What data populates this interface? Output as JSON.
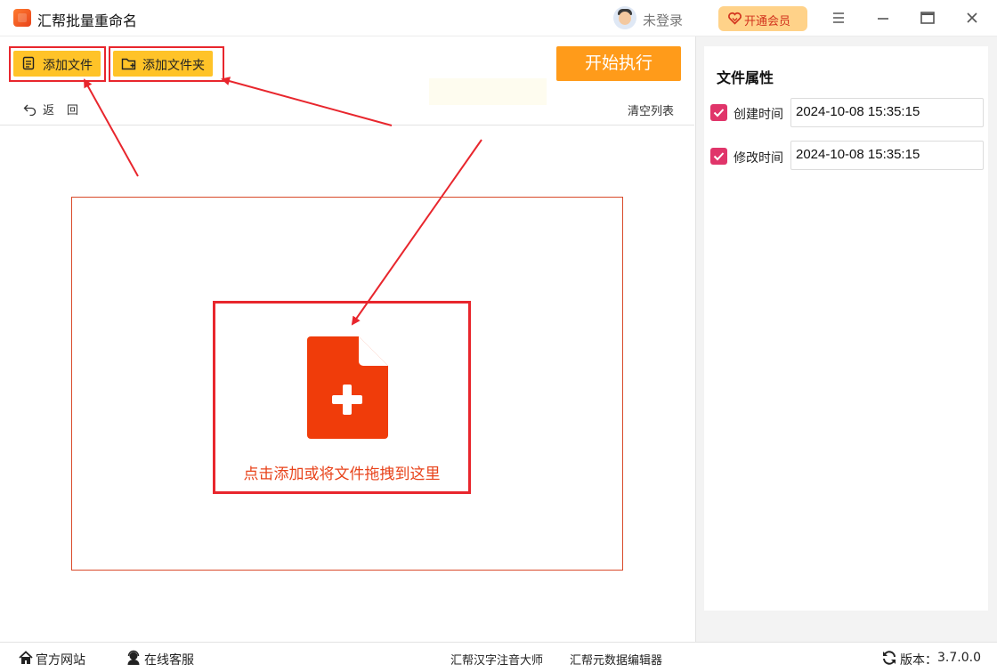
{
  "app": {
    "title": "汇帮批量重命名",
    "login_text": "未登录",
    "vip_label": "开通会员"
  },
  "toolbar": {
    "add_file_label": "添加文件",
    "add_folder_label": "添加文件夹",
    "start_label": "开始执行",
    "back_label": "返回",
    "clear_label": "清空列表"
  },
  "drop_zone": {
    "hint": "点击添加或将文件拖拽到这里"
  },
  "properties": {
    "title": "文件属性",
    "items": [
      {
        "label": "创建时间",
        "checked": true,
        "value": "2024-10-08 15:35:15"
      },
      {
        "label": "修改时间",
        "checked": true,
        "value": "2024-10-08 15:35:15"
      }
    ]
  },
  "statusbar": {
    "website_label": "官方网站",
    "support_label": "在线客服",
    "link1": "汇帮汉字注音大师",
    "link2": "汇帮元数据编辑器",
    "version_label": "版本：",
    "version": "3.7.0.0"
  },
  "colors": {
    "accent_yellow": "#ffc328",
    "start_orange": "#ff9b1a",
    "annotation_red": "#e8262d",
    "checkbox_pink": "#e0356a",
    "file_icon_red": "#f03c0a"
  },
  "icons": [
    "app-logo",
    "user-avatar-icon",
    "vip-heart-icon",
    "menu-icon",
    "minimize-icon",
    "maximize-icon",
    "close-icon",
    "add-file-icon",
    "add-folder-icon",
    "back-arrow-icon",
    "file-plus-icon",
    "home-icon",
    "support-icon",
    "refresh-icon"
  ]
}
